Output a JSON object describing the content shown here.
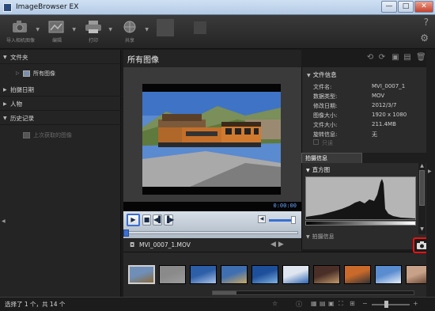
{
  "window": {
    "title": "ImageBrowser EX",
    "min": "—",
    "max": "□",
    "close": "✕"
  },
  "toolbar": {
    "tools": [
      {
        "id": "import",
        "label": "导入相机图像",
        "icon": "camera-import-icon"
      },
      {
        "id": "edit",
        "label": "编辑",
        "icon": "edit-icon"
      },
      {
        "id": "print",
        "label": "打印",
        "icon": "printer-icon"
      },
      {
        "id": "share",
        "label": "共享",
        "icon": "share-icon"
      }
    ],
    "help": "?",
    "settings": "⚙"
  },
  "sidebar": {
    "folders": "文件夹",
    "all_images": "所有图像",
    "shoot_date": "拍摄日期",
    "people": "人物",
    "history": "历史记录",
    "last_imported": "上次获取的图像"
  },
  "main": {
    "title": "所有图像"
  },
  "video": {
    "timecode": "0:00:00",
    "file_name": "MVI_0007_1.MOV",
    "controls": {
      "play": "▶",
      "stop": "■",
      "prev": "◀▌",
      "next": "▐▶"
    }
  },
  "info": {
    "file_info_header": "文件信息",
    "rows": [
      {
        "k": "文件名:",
        "v": "MVI_0007_1"
      },
      {
        "k": "数据类型:",
        "v": "MOV"
      },
      {
        "k": "修改日期:",
        "v": "2012/3/7"
      },
      {
        "k": "图像大小:",
        "v": "1920 x 1080"
      },
      {
        "k": "文件大小:",
        "v": "211.4MB"
      },
      {
        "k": "旋转信息:",
        "v": "无"
      }
    ],
    "protect": "只读",
    "tab_shooting": "拍摄信息",
    "histogram_header": "直方图",
    "more_header": "拍摄信息"
  },
  "thumbnails": [
    {
      "name": "train",
      "colors": [
        "#6f8fb8",
        "#8a6a3a"
      ]
    },
    {
      "name": "grey-blank",
      "colors": [
        "#8a8a8a",
        "#9d9d9d"
      ]
    },
    {
      "name": "blue-wave",
      "colors": [
        "#2d5fa8",
        "#aac4ea"
      ]
    },
    {
      "name": "blue-shapes",
      "colors": [
        "#3f6fb0",
        "#c9a864"
      ]
    },
    {
      "name": "water-blue",
      "colors": [
        "#1e4f9a",
        "#7fb2e4"
      ]
    },
    {
      "name": "sphere",
      "colors": [
        "#e0e6ef",
        "#2d65b4"
      ]
    },
    {
      "name": "crowd",
      "colors": [
        "#4a2f28",
        "#c29a6c"
      ]
    },
    {
      "name": "sunset",
      "colors": [
        "#c96a2b",
        "#333"
      ]
    },
    {
      "name": "sky",
      "colors": [
        "#5a8cd0",
        "#e5eef8"
      ]
    },
    {
      "name": "portrait",
      "colors": [
        "#c7a188",
        "#5d3b2a"
      ]
    }
  ],
  "status": {
    "selected": "选择了 1 个，共 14 个"
  },
  "colors": {
    "accent": "#3a6fd1",
    "timecode": "#66a3ff",
    "highlight": "#e11111"
  }
}
